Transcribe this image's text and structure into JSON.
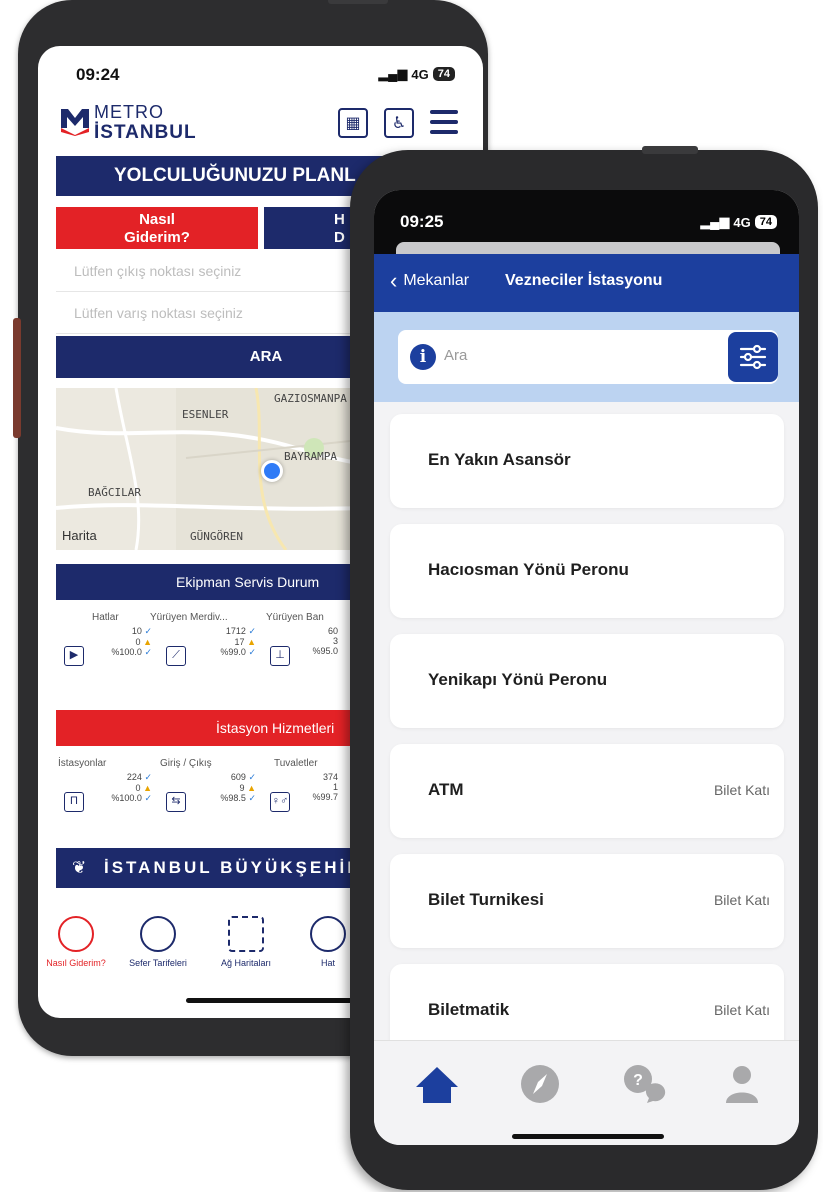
{
  "back_phone": {
    "status": {
      "time": "09:24",
      "network": "4G",
      "battery": "74"
    },
    "logo": {
      "line1": "METRO",
      "line2": "İSTANBUL"
    },
    "plan_title": "YOLCULUĞUNUZU PLANL",
    "tab_how": {
      "line1": "Nasıl",
      "line2": "Giderim?"
    },
    "tab_other": {
      "line1": "H",
      "line2": "D"
    },
    "origin_placeholder": "Lütfen çıkış noktası seçiniz",
    "destination_placeholder": "Lütfen varış noktası seçiniz",
    "search_button": "ARA",
    "map": {
      "labels": [
        "ESENLER",
        "GAZIOSMANPA",
        "BAYRAMPA",
        "BAĞCILAR",
        "GÜNGÖREN"
      ],
      "attribution": "Harita"
    },
    "equipment": {
      "title": "Ekipman Servis Durum",
      "columns": [
        "Hatlar",
        "Yürüyen Merdiv...",
        "Yürüyen Ban"
      ],
      "stats": [
        {
          "ok": "10",
          "warn": "0",
          "pct": "%100.0"
        },
        {
          "ok": "1712",
          "warn": "17",
          "pct": "%99.0"
        },
        {
          "ok": "60",
          "warn": "3",
          "pct": "%95.0"
        }
      ]
    },
    "station_services": {
      "title": "İstasyon Hizmetleri",
      "columns": [
        "İstasyonlar",
        "Giriş / Çıkış",
        "Tuvaletler"
      ],
      "stats": [
        {
          "ok": "224",
          "warn": "0",
          "pct": "%100.0"
        },
        {
          "ok": "609",
          "warn": "9",
          "pct": "%98.5"
        },
        {
          "ok": "374",
          "warn": "1",
          "pct": "%99.7"
        }
      ]
    },
    "ibb_banner": "İSTANBUL BÜYÜKŞEHİR B",
    "tabbar": [
      "Nasıl Giderim?",
      "Sefer Tarifeleri",
      "Ağ Haritaları",
      "Hat"
    ]
  },
  "front_phone": {
    "status": {
      "time": "09:25",
      "network": "4G",
      "battery": "74"
    },
    "nav": {
      "back_label": "Mekanlar",
      "title": "Vezneciler İstasyonu"
    },
    "search": {
      "placeholder": "Ara"
    },
    "items": [
      {
        "name": "En Yakın Asansör",
        "meta": ""
      },
      {
        "name": "Hacıosman Yönü Peronu",
        "meta": ""
      },
      {
        "name": "Yenikapı Yönü Peronu",
        "meta": ""
      },
      {
        "name": "ATM",
        "meta": "Bilet Katı"
      },
      {
        "name": "Bilet Turnikesi",
        "meta": "Bilet Katı"
      },
      {
        "name": "Biletmatik",
        "meta": "Bilet Katı"
      }
    ],
    "tabbar_icons": [
      "home-icon",
      "compass-icon",
      "help-chat-icon",
      "profile-icon"
    ],
    "accent_color": "#1c3f9e"
  }
}
